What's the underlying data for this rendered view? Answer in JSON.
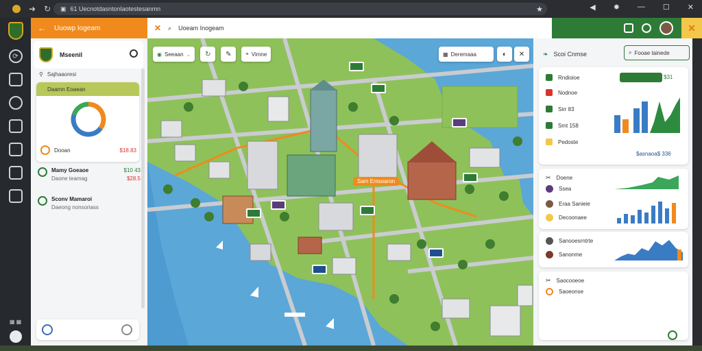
{
  "browser": {
    "url_text": "61 Uecnotdasntonlaotestesanmn",
    "nav_icons": [
      "back-icon",
      "forward-icon",
      "reload-icon"
    ]
  },
  "app": {
    "header_left_title": "Uuowp Iogeam",
    "header_mid_title": "Uoeam Inogeam",
    "brand_orange": "#f08a1c",
    "brand_green": "#2d7b37"
  },
  "left_panel": {
    "title": "Mseenil",
    "subtitle": "Sajhaaoresi",
    "card": {
      "header": "Daamn Eoaean",
      "donut": {
        "segments": [
          {
            "value": 35,
            "color": "#f08a1c"
          },
          {
            "value": 45,
            "color": "#3a7cc4"
          },
          {
            "value": 20,
            "color": "#3aa75b"
          }
        ]
      },
      "row_label": "Dooan",
      "row_amount": "$18.83"
    },
    "items": [
      {
        "name": "Mamy Goeaoe",
        "sub": "Daone teamag",
        "amt_top": "$10 43",
        "amt_bottom": "$28.5"
      },
      {
        "name": "Sconv Mamaroi",
        "sub": "Daeong nonsoriass",
        "amt_top": "",
        "amt_bottom": ""
      }
    ]
  },
  "map": {
    "toolbar_chip_label": "Seeaan",
    "toolbar_btn2_label": "Vimne",
    "search_label": "Deremaaa",
    "road_label": "Sam Emsoaron"
  },
  "right_panel": {
    "header_label": "Scoi Cnmse",
    "header_pill_label": "Fooae tainede",
    "card1": {
      "rows": [
        "Rndioioe",
        "Nodnoe",
        "Sirr 83",
        "Smt 158",
        "Pedoste"
      ],
      "badge": "",
      "top_value": "$31",
      "bottom_value": "$asnaoa$ 336"
    },
    "card2": {
      "rows": [
        "Doene",
        "Ssea",
        "Eraa Sanieie",
        "Decoonaee"
      ]
    },
    "card3": {
      "rows": [
        "Sanooesrntrte",
        "Sanonme"
      ]
    },
    "card4": {
      "rows": [
        "Saocooeoe",
        "Saoeonse"
      ]
    }
  }
}
